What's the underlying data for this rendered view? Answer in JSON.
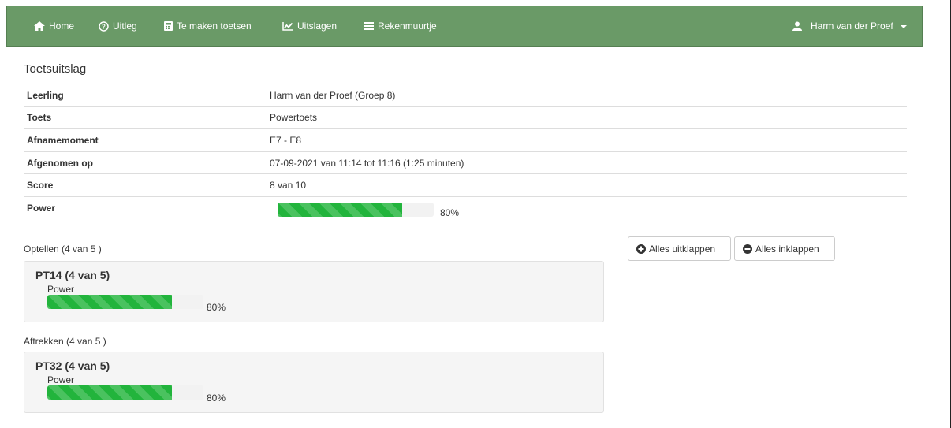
{
  "nav": {
    "home": "Home",
    "uitleg": "Uitleg",
    "te_maken": "Te maken toetsen",
    "uitslagen": "Uitslagen",
    "rekenmuurtje": "Rekenmuurtje",
    "user": "Harm van der Proef"
  },
  "page_title": "Toetsuitslag",
  "info": {
    "rows": [
      {
        "key": "Leerling",
        "value": "Harm van der Proef (Groep 8)"
      },
      {
        "key": "Toets",
        "value": "Powertoets"
      },
      {
        "key": "Afnamemoment",
        "value": "E7 - E8"
      },
      {
        "key": "Afgenomen op",
        "value": "07-09-2021 van 11:14 tot 11:16 (1:25 minuten)"
      },
      {
        "key": "Score",
        "value": "8 van 10"
      }
    ],
    "power_label": "Power",
    "power_percent": 80,
    "power_text": "80%"
  },
  "buttons": {
    "expand_all": "Alles uitklappen",
    "collapse_all": "Alles inklappen"
  },
  "groups": [
    {
      "label": "Optellen (4 van 5 )",
      "card_title": "PT14 (4 van 5)",
      "sub_label": "Power",
      "percent": 80,
      "percent_text": "80%"
    },
    {
      "label": "Aftrekken (4 van 5 )",
      "card_title": "PT32 (4 van 5)",
      "sub_label": "Power",
      "percent": 80,
      "percent_text": "80%"
    }
  ],
  "colors": {
    "navbar": "#6a9a67",
    "progress": "#22b43c"
  }
}
